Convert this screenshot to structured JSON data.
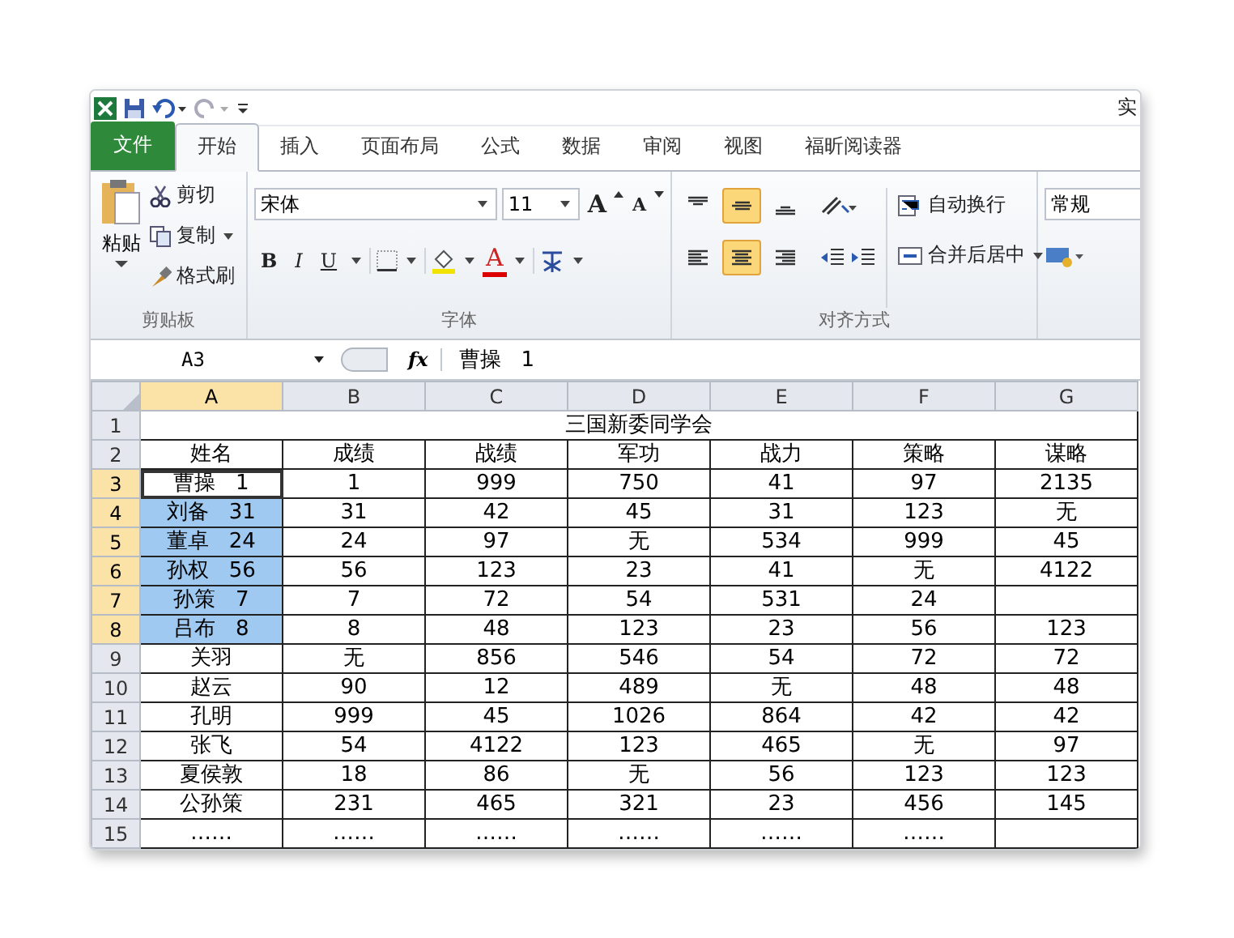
{
  "window": {
    "title": "实"
  },
  "tabs": [
    {
      "label": "文件",
      "kind": "file",
      "selected": false
    },
    {
      "label": "开始",
      "kind": "tab",
      "selected": true
    },
    {
      "label": "插入",
      "kind": "tab",
      "selected": false
    },
    {
      "label": "页面布局",
      "kind": "tab",
      "selected": false
    },
    {
      "label": "公式",
      "kind": "tab",
      "selected": false
    },
    {
      "label": "数据",
      "kind": "tab",
      "selected": false
    },
    {
      "label": "审阅",
      "kind": "tab",
      "selected": false
    },
    {
      "label": "视图",
      "kind": "tab",
      "selected": false
    },
    {
      "label": "福昕阅读器",
      "kind": "tab",
      "selected": false
    }
  ],
  "clipboard": {
    "paste": "粘贴",
    "cut": "剪切",
    "copy": "复制",
    "painter": "格式刷",
    "label": "剪贴板"
  },
  "font": {
    "name": "宋体",
    "size": "11",
    "grow": "A",
    "shrink": "A",
    "bold": "B",
    "italic": "I",
    "underline": "U",
    "font_color": "A",
    "label": "字体"
  },
  "alignment": {
    "vertical": [
      {
        "kind": "top",
        "selected": false
      },
      {
        "kind": "middle",
        "selected": true
      },
      {
        "kind": "bottom",
        "selected": false
      }
    ],
    "horizontal": [
      {
        "kind": "left",
        "selected": false
      },
      {
        "kind": "center",
        "selected": true
      },
      {
        "kind": "right",
        "selected": false
      }
    ],
    "wrap": "自动换行",
    "merge": "合并后居中",
    "label": "对齐方式"
  },
  "number": {
    "format": "常规"
  },
  "formula_bar": {
    "name_box": "A3",
    "fx": "fx",
    "value": "曹操   1"
  },
  "sheet": {
    "columns": [
      {
        "label": "A",
        "selected": true
      },
      {
        "label": "B",
        "selected": false
      },
      {
        "label": "C",
        "selected": false
      },
      {
        "label": "D",
        "selected": false
      },
      {
        "label": "E",
        "selected": false
      },
      {
        "label": "F",
        "selected": false
      },
      {
        "label": "G",
        "selected": false
      }
    ],
    "title_row": {
      "header": "1",
      "text": "三国新委同学会"
    },
    "rows": [
      {
        "header": "2",
        "selected": false,
        "active": false,
        "cells": [
          "姓名",
          "成绩",
          "战绩",
          "军功",
          "战力",
          "策略",
          "谋略"
        ]
      },
      {
        "header": "3",
        "selected": true,
        "active": true,
        "cells": [
          "曹操   1",
          "1",
          "999",
          "750",
          "41",
          "97",
          "2135"
        ]
      },
      {
        "header": "4",
        "selected": true,
        "active": false,
        "cells": [
          "刘备   31",
          "31",
          "42",
          "45",
          "31",
          "123",
          "无"
        ]
      },
      {
        "header": "5",
        "selected": true,
        "active": false,
        "cells": [
          "董卓   24",
          "24",
          "97",
          "无",
          "534",
          "999",
          "45"
        ]
      },
      {
        "header": "6",
        "selected": true,
        "active": false,
        "cells": [
          "孙权   56",
          "56",
          "123",
          "23",
          "41",
          "无",
          "4122"
        ]
      },
      {
        "header": "7",
        "selected": true,
        "active": false,
        "cells": [
          "孙策   7",
          "7",
          "72",
          "54",
          "531",
          "24",
          ""
        ]
      },
      {
        "header": "8",
        "selected": true,
        "active": false,
        "cells": [
          "吕布   8",
          "8",
          "48",
          "123",
          "23",
          "56",
          "123"
        ]
      },
      {
        "header": "9",
        "selected": false,
        "active": false,
        "cells": [
          "关羽",
          "无",
          "856",
          "546",
          "54",
          "72",
          "72"
        ]
      },
      {
        "header": "10",
        "selected": false,
        "active": false,
        "cells": [
          "赵云",
          "90",
          "12",
          "489",
          "无",
          "48",
          "48"
        ]
      },
      {
        "header": "11",
        "selected": false,
        "active": false,
        "cells": [
          "孔明",
          "999",
          "45",
          "1026",
          "864",
          "42",
          "42"
        ]
      },
      {
        "header": "12",
        "selected": false,
        "active": false,
        "cells": [
          "张飞",
          "54",
          "4122",
          "123",
          "465",
          "无",
          "97"
        ]
      },
      {
        "header": "13",
        "selected": false,
        "active": false,
        "cells": [
          "夏侯敦",
          "18",
          "86",
          "无",
          "56",
          "123",
          "123"
        ]
      },
      {
        "header": "14",
        "selected": false,
        "active": false,
        "cells": [
          "公孙策",
          "231",
          "465",
          "321",
          "23",
          "456",
          "145"
        ]
      },
      {
        "header": "15",
        "selected": false,
        "active": false,
        "cells": [
          "……",
          "……",
          "……",
          "……",
          "……",
          "……",
          ""
        ]
      }
    ]
  }
}
